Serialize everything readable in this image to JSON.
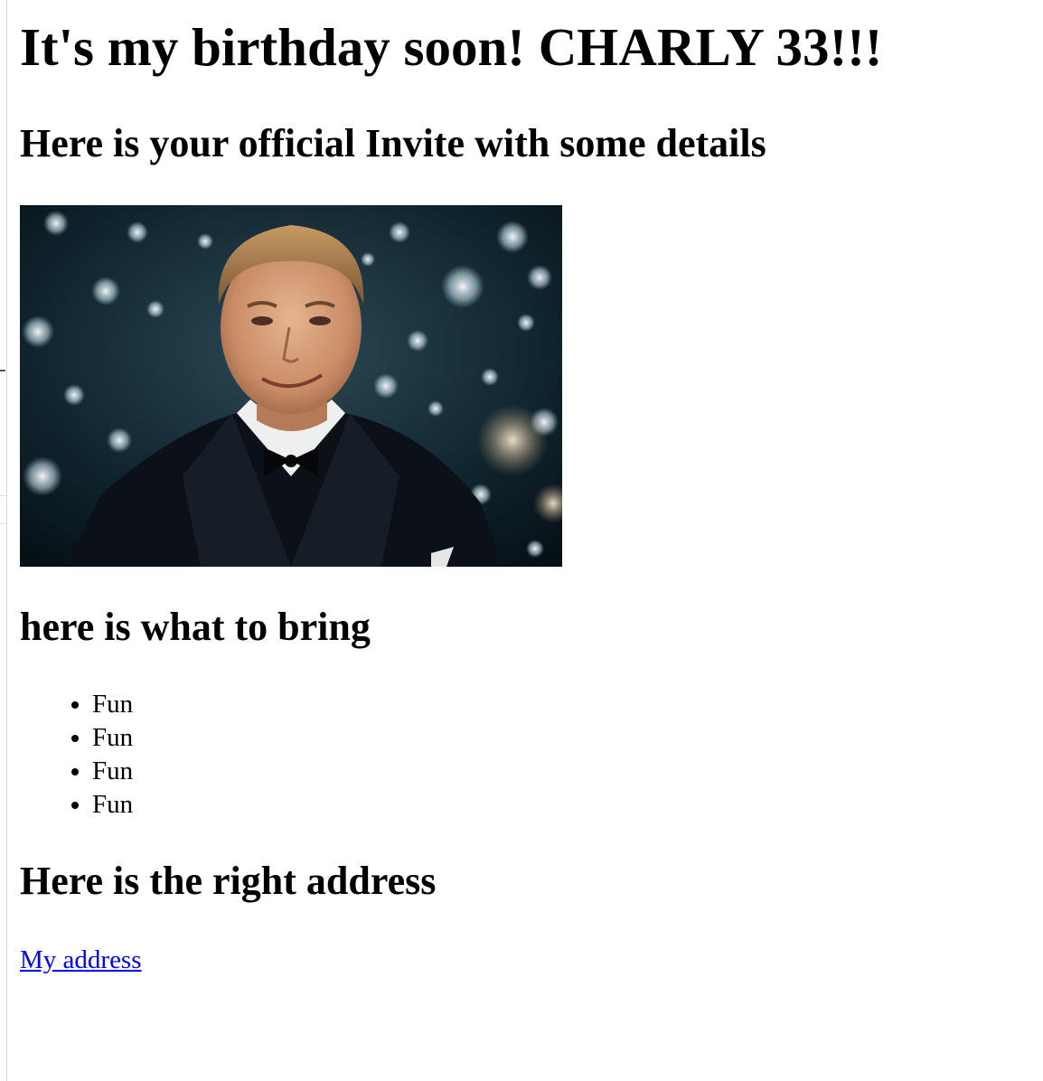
{
  "page": {
    "title": "It's my birthday soon! CHARLY 33!!!",
    "subtitle": "Here is your official Invite with some details"
  },
  "hero_image": {
    "alt": "celebratory toast gif",
    "icon": "image"
  },
  "bring": {
    "heading": "here is what to bring",
    "items": [
      "Fun",
      "Fun",
      "Fun",
      "Fun"
    ]
  },
  "address": {
    "heading": "Here is the right address",
    "link_text": "My address"
  },
  "colors": {
    "link": "#0000ee",
    "text": "#000000",
    "background": "#ffffff"
  }
}
